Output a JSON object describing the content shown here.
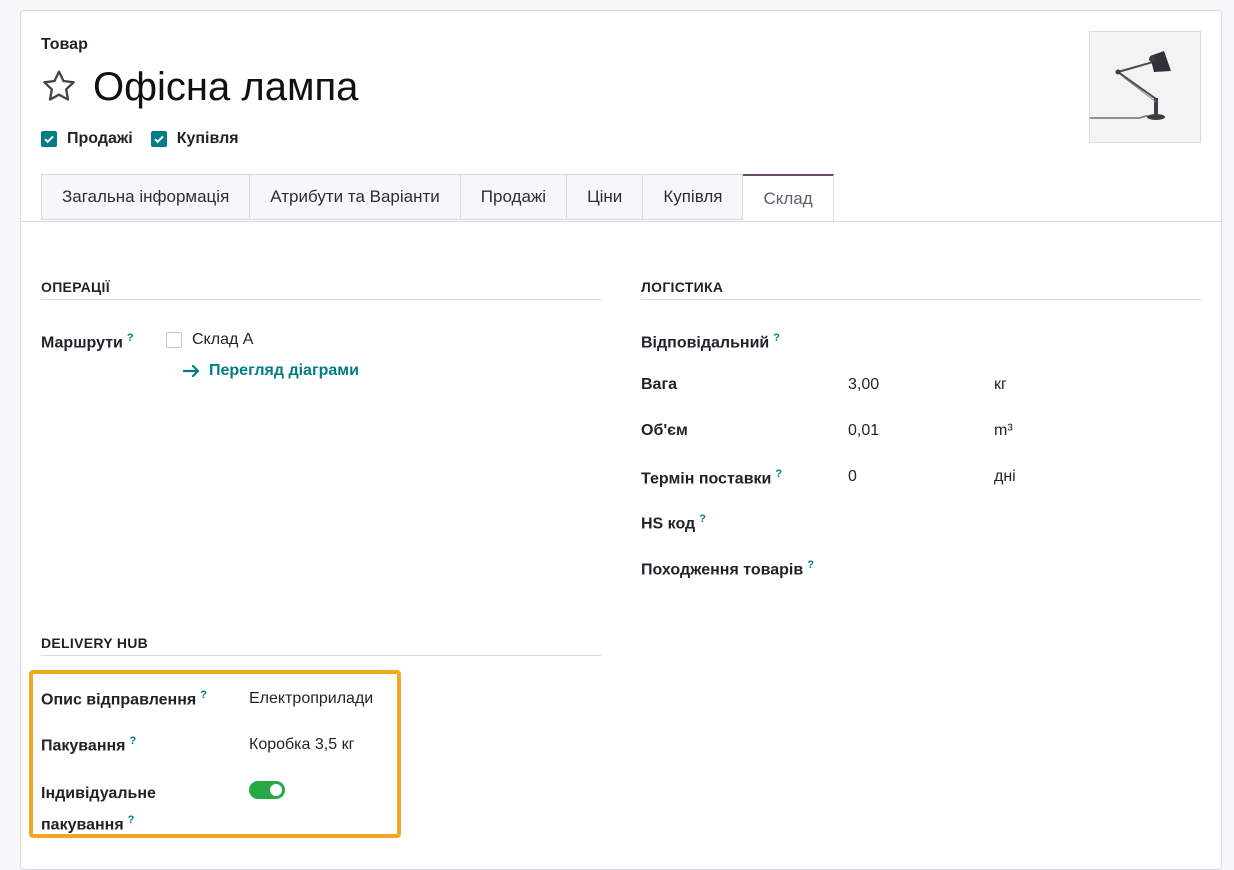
{
  "header": {
    "record_type": "Товар",
    "title": "Офісна лампа",
    "flags": [
      {
        "label": "Продажі",
        "checked": true
      },
      {
        "label": "Купівля",
        "checked": true
      }
    ]
  },
  "tabs": [
    {
      "label": "Загальна інформація",
      "active": false
    },
    {
      "label": "Атрибути та Варіанти",
      "active": false
    },
    {
      "label": "Продажі",
      "active": false
    },
    {
      "label": "Ціни",
      "active": false
    },
    {
      "label": "Купівля",
      "active": false
    },
    {
      "label": "Склад",
      "active": true
    }
  ],
  "operations": {
    "heading": "ОПЕРАЦІЇ",
    "routes_label": "Маршрути",
    "route_option": "Склад А",
    "diagram_link": "Перегляд діаграми"
  },
  "logistics": {
    "heading": "ЛОГІСТИКА",
    "fields": [
      {
        "label": "Відповідальний",
        "help": true,
        "value": "",
        "unit": ""
      },
      {
        "label": "Вага",
        "help": false,
        "value": "3,00",
        "unit": "кг"
      },
      {
        "label": "Об'єм",
        "help": false,
        "value": "0,01",
        "unit": "m³"
      },
      {
        "label": "Термін поставки",
        "help": true,
        "value": "0",
        "unit": "дні"
      },
      {
        "label": "HS код",
        "help": true,
        "value": "",
        "unit": ""
      },
      {
        "label": "Походження товарів",
        "help": true,
        "value": "",
        "unit": ""
      }
    ]
  },
  "delivery_hub": {
    "heading": "DELIVERY HUB",
    "shipment_desc_label": "Опис відправлення",
    "shipment_desc_value": "Електроприлади",
    "packaging_label": "Пакування",
    "packaging_value": "Коробка 3,5 кг",
    "individual_label_1": "Індивідуальне",
    "individual_label_2": "пакування",
    "individual_enabled": true
  },
  "help_mark": "?",
  "colors": {
    "accent": "#017e84",
    "highlight": "#f5a623",
    "toggle_on": "#28a745",
    "active_tab_border": "#6b4a6b"
  }
}
